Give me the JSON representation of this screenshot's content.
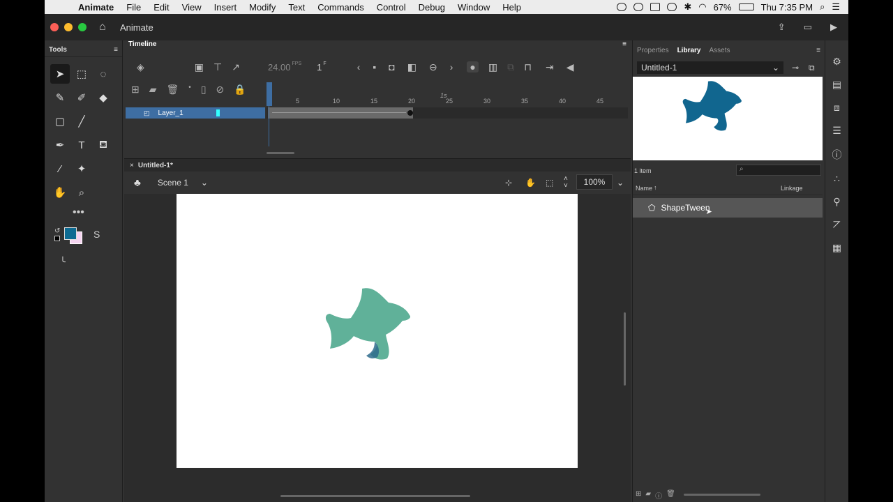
{
  "menubar": {
    "app": "Animate",
    "items": [
      "File",
      "Edit",
      "View",
      "Insert",
      "Modify",
      "Text",
      "Commands",
      "Control",
      "Debug",
      "Window",
      "Help"
    ],
    "battery": "67%",
    "clock": "Thu 7:35 PM"
  },
  "appbar": {
    "doc_title": "Animate"
  },
  "tools": {
    "title": "Tools"
  },
  "timeline": {
    "title": "Timeline",
    "fps": "24.00",
    "fps_unit": "FPS",
    "current_frame": "1",
    "frame_unit": "F",
    "ruler_seconds": "1s",
    "ruler_ticks": [
      "5",
      "10",
      "15",
      "20",
      "25",
      "30",
      "35",
      "40",
      "45"
    ],
    "layer_name": "Layer_1"
  },
  "document": {
    "tab": "Untitled-1*",
    "scene": "Scene 1",
    "zoom": "100%"
  },
  "library": {
    "tabs": [
      "Properties",
      "Library",
      "Assets"
    ],
    "doc": "Untitled-1",
    "count": "1 item",
    "col_name": "Name",
    "col_linkage": "Linkage",
    "items": [
      {
        "name": "ShapeTween"
      }
    ]
  },
  "colors": {
    "stroke": "#0d6b92",
    "fill_stage": "#4fa88e",
    "preview_fill": "#11668f",
    "layer_bg": "#3e6ea3"
  }
}
